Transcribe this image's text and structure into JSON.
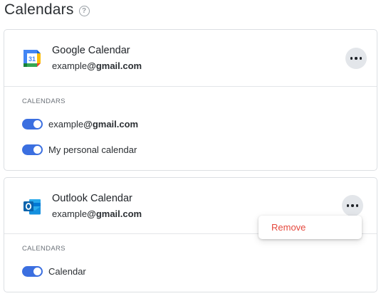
{
  "page": {
    "title": "Calendars",
    "help_icon": "help-icon"
  },
  "accounts": [
    {
      "provider": "Google Calendar",
      "logo_icon": "google-calendar-icon",
      "email_local": "example",
      "email_domain": "@gmail.com",
      "section_label": "CALENDARS",
      "calendars": [
        {
          "label_prefix": "example",
          "label_domain": "@gmail.com",
          "enabled": true
        },
        {
          "label": "My personal calendar",
          "enabled": true
        }
      ]
    },
    {
      "provider": "Outlook Calendar",
      "logo_icon": "outlook-icon",
      "email_local": "example",
      "email_domain": "@gmail.com",
      "section_label": "CALENDARS",
      "calendars": [
        {
          "label": "Calendar",
          "enabled": true
        }
      ]
    }
  ],
  "menu": {
    "remove_label": "Remove",
    "remove_color": "#e5483d"
  },
  "colors": {
    "toggle_on": "#3b6fe0",
    "more_button_bg": "#e3e6ea",
    "border": "#dcdfe3"
  }
}
